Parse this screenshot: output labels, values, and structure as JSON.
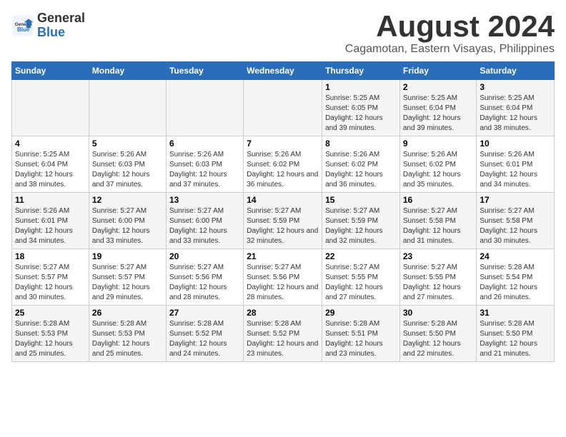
{
  "header": {
    "logo_line1": "General",
    "logo_line2": "Blue",
    "title": "August 2024",
    "subtitle": "Cagamotan, Eastern Visayas, Philippines"
  },
  "days_of_week": [
    "Sunday",
    "Monday",
    "Tuesday",
    "Wednesday",
    "Thursday",
    "Friday",
    "Saturday"
  ],
  "weeks": [
    [
      {
        "day": "",
        "info": ""
      },
      {
        "day": "",
        "info": ""
      },
      {
        "day": "",
        "info": ""
      },
      {
        "day": "",
        "info": ""
      },
      {
        "day": "1",
        "info": "Sunrise: 5:25 AM\nSunset: 6:05 PM\nDaylight: 12 hours and 39 minutes."
      },
      {
        "day": "2",
        "info": "Sunrise: 5:25 AM\nSunset: 6:04 PM\nDaylight: 12 hours and 39 minutes."
      },
      {
        "day": "3",
        "info": "Sunrise: 5:25 AM\nSunset: 6:04 PM\nDaylight: 12 hours and 38 minutes."
      }
    ],
    [
      {
        "day": "4",
        "info": "Sunrise: 5:25 AM\nSunset: 6:04 PM\nDaylight: 12 hours and 38 minutes."
      },
      {
        "day": "5",
        "info": "Sunrise: 5:26 AM\nSunset: 6:03 PM\nDaylight: 12 hours and 37 minutes."
      },
      {
        "day": "6",
        "info": "Sunrise: 5:26 AM\nSunset: 6:03 PM\nDaylight: 12 hours and 37 minutes."
      },
      {
        "day": "7",
        "info": "Sunrise: 5:26 AM\nSunset: 6:02 PM\nDaylight: 12 hours and 36 minutes."
      },
      {
        "day": "8",
        "info": "Sunrise: 5:26 AM\nSunset: 6:02 PM\nDaylight: 12 hours and 36 minutes."
      },
      {
        "day": "9",
        "info": "Sunrise: 5:26 AM\nSunset: 6:02 PM\nDaylight: 12 hours and 35 minutes."
      },
      {
        "day": "10",
        "info": "Sunrise: 5:26 AM\nSunset: 6:01 PM\nDaylight: 12 hours and 34 minutes."
      }
    ],
    [
      {
        "day": "11",
        "info": "Sunrise: 5:26 AM\nSunset: 6:01 PM\nDaylight: 12 hours and 34 minutes."
      },
      {
        "day": "12",
        "info": "Sunrise: 5:27 AM\nSunset: 6:00 PM\nDaylight: 12 hours and 33 minutes."
      },
      {
        "day": "13",
        "info": "Sunrise: 5:27 AM\nSunset: 6:00 PM\nDaylight: 12 hours and 33 minutes."
      },
      {
        "day": "14",
        "info": "Sunrise: 5:27 AM\nSunset: 5:59 PM\nDaylight: 12 hours and 32 minutes."
      },
      {
        "day": "15",
        "info": "Sunrise: 5:27 AM\nSunset: 5:59 PM\nDaylight: 12 hours and 32 minutes."
      },
      {
        "day": "16",
        "info": "Sunrise: 5:27 AM\nSunset: 5:58 PM\nDaylight: 12 hours and 31 minutes."
      },
      {
        "day": "17",
        "info": "Sunrise: 5:27 AM\nSunset: 5:58 PM\nDaylight: 12 hours and 30 minutes."
      }
    ],
    [
      {
        "day": "18",
        "info": "Sunrise: 5:27 AM\nSunset: 5:57 PM\nDaylight: 12 hours and 30 minutes."
      },
      {
        "day": "19",
        "info": "Sunrise: 5:27 AM\nSunset: 5:57 PM\nDaylight: 12 hours and 29 minutes."
      },
      {
        "day": "20",
        "info": "Sunrise: 5:27 AM\nSunset: 5:56 PM\nDaylight: 12 hours and 28 minutes."
      },
      {
        "day": "21",
        "info": "Sunrise: 5:27 AM\nSunset: 5:56 PM\nDaylight: 12 hours and 28 minutes."
      },
      {
        "day": "22",
        "info": "Sunrise: 5:27 AM\nSunset: 5:55 PM\nDaylight: 12 hours and 27 minutes."
      },
      {
        "day": "23",
        "info": "Sunrise: 5:27 AM\nSunset: 5:55 PM\nDaylight: 12 hours and 27 minutes."
      },
      {
        "day": "24",
        "info": "Sunrise: 5:28 AM\nSunset: 5:54 PM\nDaylight: 12 hours and 26 minutes."
      }
    ],
    [
      {
        "day": "25",
        "info": "Sunrise: 5:28 AM\nSunset: 5:53 PM\nDaylight: 12 hours and 25 minutes."
      },
      {
        "day": "26",
        "info": "Sunrise: 5:28 AM\nSunset: 5:53 PM\nDaylight: 12 hours and 25 minutes."
      },
      {
        "day": "27",
        "info": "Sunrise: 5:28 AM\nSunset: 5:52 PM\nDaylight: 12 hours and 24 minutes."
      },
      {
        "day": "28",
        "info": "Sunrise: 5:28 AM\nSunset: 5:52 PM\nDaylight: 12 hours and 23 minutes."
      },
      {
        "day": "29",
        "info": "Sunrise: 5:28 AM\nSunset: 5:51 PM\nDaylight: 12 hours and 23 minutes."
      },
      {
        "day": "30",
        "info": "Sunrise: 5:28 AM\nSunset: 5:50 PM\nDaylight: 12 hours and 22 minutes."
      },
      {
        "day": "31",
        "info": "Sunrise: 5:28 AM\nSunset: 5:50 PM\nDaylight: 12 hours and 21 minutes."
      }
    ]
  ]
}
